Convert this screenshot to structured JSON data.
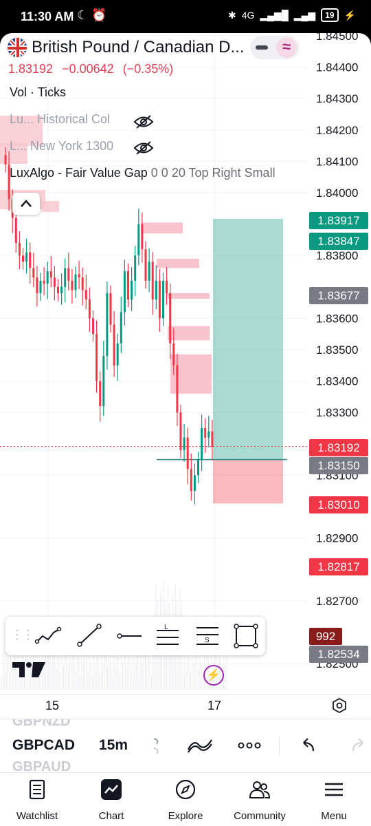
{
  "status_bar": {
    "time": "11:30 AM",
    "network": "4G",
    "battery": "19"
  },
  "header": {
    "title": "British Pound / Canadian D...",
    "last_price": "1.83192",
    "change": "−0.00642",
    "change_pct": "(−0.35%)",
    "toggle_icon": "≈"
  },
  "indicators": {
    "volume": "Vol · Ticks",
    "historical": "Lu...  Historical Col",
    "newyork": "L...  New York 1300",
    "luxalgo_name": "LuxAlgo - Fair Value Gap",
    "luxalgo_params": "0 0 20 Top Right Small"
  },
  "chart_data": {
    "type": "candlestick",
    "symbol": "GBPCAD",
    "interval": "15m",
    "y_ticks": [
      "1.84500",
      "1.84400",
      "1.84300",
      "1.84200",
      "1.84100",
      "1.84000",
      "1.83800",
      "1.83600",
      "1.83500",
      "1.83400",
      "1.83300",
      "1.83100",
      "1.82900",
      "1.82700",
      "1.82500"
    ],
    "x_ticks": [
      "15",
      "17"
    ],
    "price_labels": [
      {
        "text": "1.83917",
        "color": "#089981"
      },
      {
        "text": "1.83847",
        "color": "#089981"
      },
      {
        "text": "1.83677",
        "color": "#787b86"
      },
      {
        "text": "1.83192",
        "color": "#f23645"
      },
      {
        "text": "1.83150",
        "color": "#787b86"
      },
      {
        "text": "1.83010",
        "color": "#f23645"
      },
      {
        "text": "1.82817",
        "color": "#f23645"
      },
      {
        "text": "992",
        "color": "#8b1c1c"
      },
      {
        "text": "1.82534",
        "color": "#787b86"
      }
    ],
    "position": {
      "type": "long",
      "entry": 1.8315,
      "take_profit": 1.83917,
      "stop_loss": 1.8301
    },
    "fair_value_gaps": [
      {
        "top": 1.83905,
        "bottom": 1.8387
      },
      {
        "top": 1.8379,
        "bottom": 1.8376
      },
      {
        "top": 1.8368,
        "bottom": 1.83665
      },
      {
        "top": 1.83575,
        "bottom": 1.8353
      },
      {
        "top": 1.83485,
        "bottom": 1.8336
      }
    ],
    "candles_close": [
      1.8409,
      1.8398,
      1.8392,
      1.8384,
      1.838,
      1.8378,
      1.8381,
      1.8376,
      1.8373,
      1.8368,
      1.8372,
      1.8371,
      1.8375,
      1.8373,
      1.837,
      1.8368,
      1.837,
      1.8376,
      1.8372,
      1.8369,
      1.8374,
      1.8373,
      1.8369,
      1.8366,
      1.836,
      1.8355,
      1.834,
      1.8332,
      1.8348,
      1.8368,
      1.8358,
      1.8345,
      1.8352,
      1.8362,
      1.8375,
      1.8366,
      1.8372,
      1.838,
      1.839,
      1.8382,
      1.8372,
      1.8378,
      1.8366,
      1.8372,
      1.836,
      1.8372,
      1.8368,
      1.8352,
      1.8345,
      1.833,
      1.8318,
      1.8322,
      1.8312,
      1.8305,
      1.831,
      1.8315,
      1.8325,
      1.8322,
      1.8324,
      1.8319
    ]
  },
  "drawing_tools": [
    "trend-angle",
    "trend-line",
    "horizontal-ray",
    "long-position",
    "short-position",
    "rectangle"
  ],
  "symbol_bar": {
    "prev_symbol": "GBPNZD",
    "symbol": "GBPCAD",
    "next_symbol": "GBPAUD",
    "interval": "15m"
  },
  "bottom_nav": [
    {
      "label": "Watchlist",
      "icon": "watchlist-icon"
    },
    {
      "label": "Chart",
      "icon": "chart-icon"
    },
    {
      "label": "Explore",
      "icon": "compass-icon"
    },
    {
      "label": "Community",
      "icon": "community-icon"
    },
    {
      "label": "Menu",
      "icon": "menu-icon"
    }
  ]
}
